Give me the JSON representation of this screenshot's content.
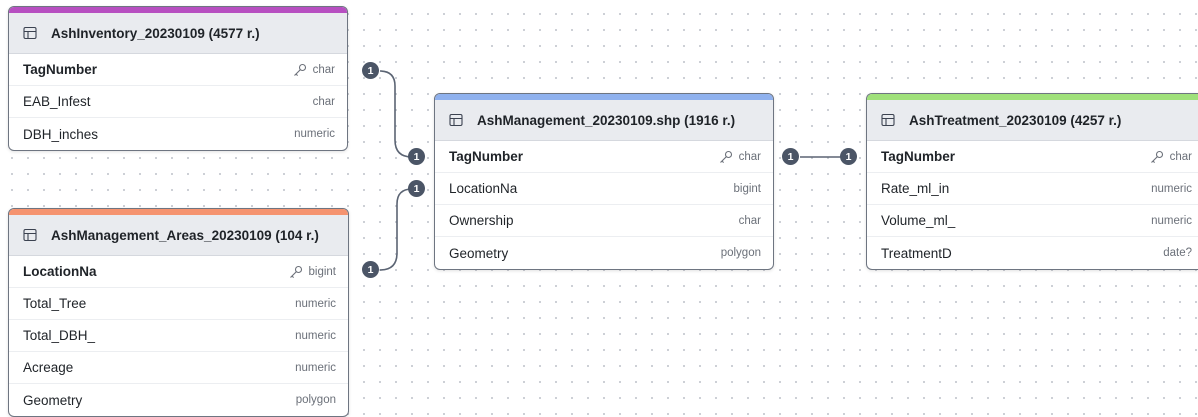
{
  "tables": [
    {
      "id": "ash-inventory",
      "title": "AshInventory_20230109 (4577 r.)",
      "accent": "#b74fc1",
      "fields": [
        {
          "name": "TagNumber",
          "type": "char",
          "key": true
        },
        {
          "name": "EAB_Infest",
          "type": "char",
          "key": false
        },
        {
          "name": "DBH_inches",
          "type": "numeric",
          "key": false
        }
      ]
    },
    {
      "id": "ash-management-areas",
      "title": "AshManagement_Areas_20230109 (104 r.)",
      "accent": "#f5936f",
      "fields": [
        {
          "name": "LocationNa",
          "type": "bigint",
          "key": true
        },
        {
          "name": "Total_Tree",
          "type": "numeric",
          "key": false
        },
        {
          "name": "Total_DBH_",
          "type": "numeric",
          "key": false
        },
        {
          "name": "Acreage",
          "type": "numeric",
          "key": false
        },
        {
          "name": "Geometry",
          "type": "polygon",
          "key": false
        }
      ]
    },
    {
      "id": "ash-management-shp",
      "title": "AshManagement_20230109.shp (1916 r.)",
      "accent": "#8fb1ee",
      "fields": [
        {
          "name": "TagNumber",
          "type": "char",
          "key": true
        },
        {
          "name": "LocationNa",
          "type": "bigint",
          "key": false
        },
        {
          "name": "Ownership",
          "type": "char",
          "key": false
        },
        {
          "name": "Geometry",
          "type": "polygon",
          "key": false
        }
      ]
    },
    {
      "id": "ash-treatment",
      "title": "AshTreatment_20230109 (4257 r.)",
      "accent": "#9fe07a",
      "fields": [
        {
          "name": "TagNumber",
          "type": "char",
          "key": true
        },
        {
          "name": "Rate_ml_in",
          "type": "numeric",
          "key": false
        },
        {
          "name": "Volume_ml_",
          "type": "numeric",
          "key": false
        },
        {
          "name": "TreatmentD",
          "type": "date?",
          "key": false
        }
      ]
    }
  ],
  "relationships": [
    {
      "from_table": "AshInventory_20230109",
      "from_field": "TagNumber",
      "to_table": "AshManagement_20230109.shp",
      "to_field": "TagNumber",
      "cardinality": [
        "1",
        "1"
      ]
    },
    {
      "from_table": "AshManagement_Areas_20230109",
      "from_field": "LocationNa",
      "to_table": "AshManagement_20230109.shp",
      "to_field": "LocationNa",
      "cardinality": [
        "1",
        "1"
      ]
    },
    {
      "from_table": "AshManagement_20230109.shp",
      "from_field": "TagNumber",
      "to_table": "AshTreatment_20230109",
      "to_field": "TagNumber",
      "cardinality": [
        "1",
        "1"
      ]
    }
  ],
  "icons": {
    "table_header": "table-grid-icon",
    "primary_key": "key-icon"
  },
  "colors": {
    "connector": "#4b5566",
    "link_line": "#5b6473",
    "card_border": "#6e7581"
  }
}
